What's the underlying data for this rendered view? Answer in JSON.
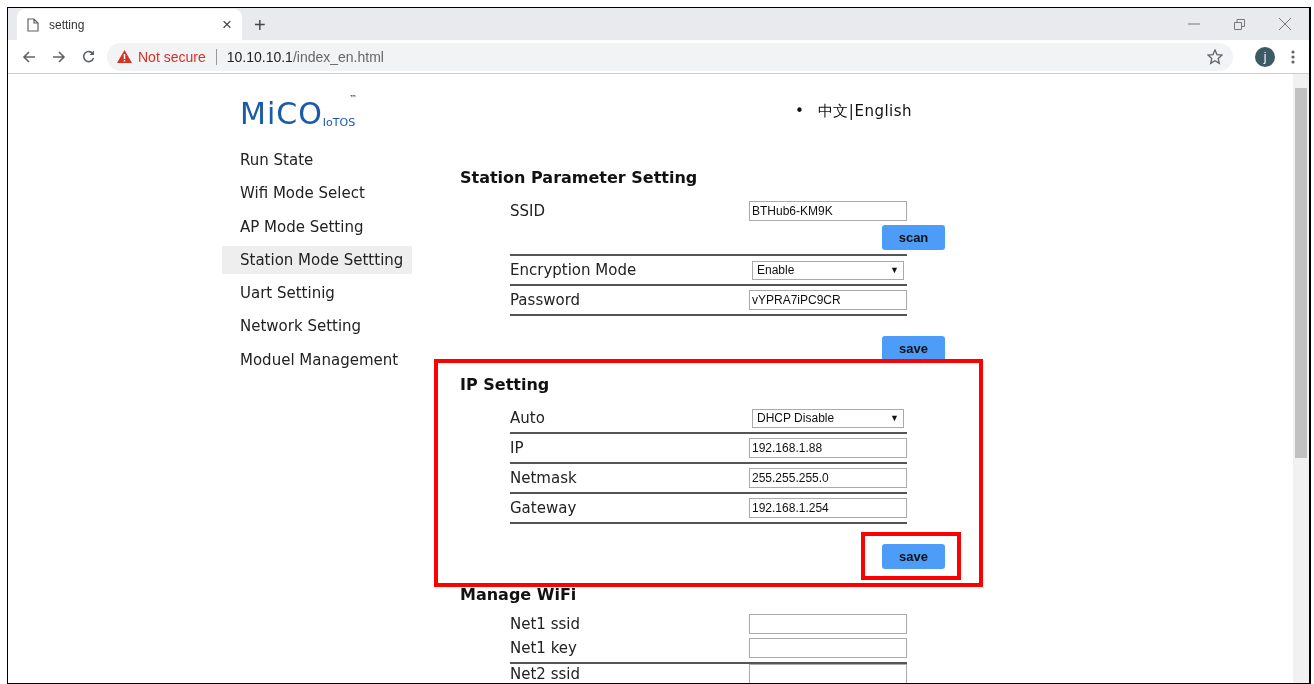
{
  "browser": {
    "tab_title": "setting",
    "tab_close": "×",
    "new_tab": "+",
    "security": "Not secure",
    "url_host": "10.10.10.1",
    "url_path": "/index_en.html",
    "avatar": "j"
  },
  "logo": {
    "text": "MiCO",
    "sub": "IoTOS",
    "tm": "™"
  },
  "language": {
    "bullet": "•",
    "text": "中文|English"
  },
  "sidebar": {
    "items": [
      {
        "label": "Run State",
        "selected": false
      },
      {
        "label": "Wifi Mode Select",
        "selected": false
      },
      {
        "label": "AP Mode Setting",
        "selected": false
      },
      {
        "label": "Station Mode Settting",
        "selected": true
      },
      {
        "label": "Uart Settinig",
        "selected": false
      },
      {
        "label": "Network Setting",
        "selected": false
      },
      {
        "label": "Moduel Management",
        "selected": false
      }
    ]
  },
  "sections": [
    {
      "title": "Station Parameter Setting",
      "rows": [
        {
          "label": "SSID",
          "kind": "text",
          "value": "BTHub6-KM9K",
          "button": "scan",
          "divider": true
        },
        {
          "label": "Encryption Mode",
          "kind": "select",
          "value": "Enable",
          "arrow": "▼",
          "divider": true
        },
        {
          "label": "Password",
          "kind": "text",
          "value": "vYPRA7iPC9CR",
          "divider": true
        }
      ],
      "button": "save"
    },
    {
      "title": "IP Setting",
      "rows": [
        {
          "label": "Auto",
          "kind": "select",
          "value": "DHCP Disable",
          "arrow": "▼",
          "divider": true
        },
        {
          "label": "IP",
          "kind": "text",
          "value": "192.168.1.88",
          "divider": true
        },
        {
          "label": "Netmask",
          "kind": "text",
          "value": "255.255.255.0",
          "divider": true
        },
        {
          "label": "Gateway",
          "kind": "text",
          "value": "192.168.1.254",
          "divider": true
        }
      ],
      "button": "save"
    },
    {
      "title": "Manage WiFi",
      "rows": [
        {
          "label": "Net1 ssid",
          "kind": "text",
          "value": "",
          "divider": false
        },
        {
          "label": "Net1 key",
          "kind": "text",
          "value": "",
          "divider": true
        },
        {
          "label": "Net2 ssid",
          "kind": "text",
          "value": "",
          "divider": false
        }
      ]
    }
  ]
}
